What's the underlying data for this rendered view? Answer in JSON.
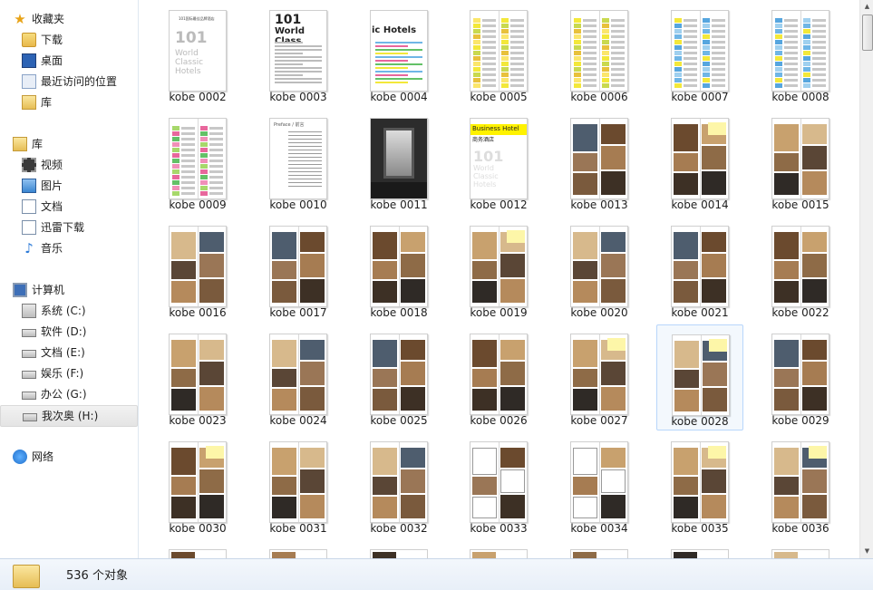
{
  "sidebar": {
    "favorites": {
      "label": "收藏夹",
      "icon": "star-icon"
    },
    "favorites_items": [
      {
        "label": "下载",
        "icon": "downloads-folder-icon"
      },
      {
        "label": "桌面",
        "icon": "desktop-icon"
      },
      {
        "label": "最近访问的位置",
        "icon": "recent-places-icon"
      },
      {
        "label": "库",
        "icon": "library-icon"
      }
    ],
    "libraries": {
      "label": "库",
      "icon": "libraries-icon"
    },
    "libraries_items": [
      {
        "label": "视频",
        "icon": "video-library-icon"
      },
      {
        "label": "图片",
        "icon": "pictures-library-icon"
      },
      {
        "label": "文档",
        "icon": "documents-library-icon"
      },
      {
        "label": "迅雷下载",
        "icon": "thunder-download-icon"
      },
      {
        "label": "音乐",
        "icon": "music-library-icon"
      }
    ],
    "computer": {
      "label": "计算机",
      "icon": "computer-icon"
    },
    "drives": [
      {
        "label": "系统 (C:)",
        "icon": "system-drive-icon"
      },
      {
        "label": "软件 (D:)",
        "icon": "drive-icon"
      },
      {
        "label": "文档 (E:)",
        "icon": "drive-icon"
      },
      {
        "label": "娱乐 (F:)",
        "icon": "drive-icon"
      },
      {
        "label": "办公 (G:)",
        "icon": "drive-icon"
      },
      {
        "label": "我次奥 (H:)",
        "icon": "drive-icon",
        "selected": true
      }
    ],
    "network": {
      "label": "网络",
      "icon": "network-icon"
    }
  },
  "files": [
    {
      "name": "kobe 0002",
      "style": "title",
      "text": [
        "101国际最佳品牌酒店",
        "101",
        "World",
        "Classic",
        "Hotels"
      ]
    },
    {
      "name": "kobe 0003",
      "style": "worldclass",
      "text": [
        "101",
        "World Class"
      ]
    },
    {
      "name": "kobe 0004",
      "style": "ichotels",
      "text": [
        "ic Hotels"
      ]
    },
    {
      "name": "kobe 0005",
      "style": "list-yellow"
    },
    {
      "name": "kobe 0006",
      "style": "list-yellow"
    },
    {
      "name": "kobe 0007",
      "style": "list-blue"
    },
    {
      "name": "kobe 0008",
      "style": "list-blue"
    },
    {
      "name": "kobe 0009",
      "style": "list-pink"
    },
    {
      "name": "kobe 0010",
      "style": "text",
      "text": [
        "Preface / 前言"
      ]
    },
    {
      "name": "kobe 0011",
      "style": "dark"
    },
    {
      "name": "kobe 0012",
      "style": "business",
      "text": [
        "Business Hotel",
        "商务酒店",
        "101",
        "World",
        "Classic",
        "Hotels"
      ]
    },
    {
      "name": "kobe 0013",
      "style": "photos"
    },
    {
      "name": "kobe 0014",
      "style": "photos-yellow"
    },
    {
      "name": "kobe 0015",
      "style": "photos"
    },
    {
      "name": "kobe 0016",
      "style": "photos"
    },
    {
      "name": "kobe 0017",
      "style": "photos"
    },
    {
      "name": "kobe 0018",
      "style": "photos"
    },
    {
      "name": "kobe 0019",
      "style": "photos-yellow"
    },
    {
      "name": "kobe 0020",
      "style": "photos"
    },
    {
      "name": "kobe 0021",
      "style": "photos"
    },
    {
      "name": "kobe 0022",
      "style": "photos"
    },
    {
      "name": "kobe 0023",
      "style": "photos"
    },
    {
      "name": "kobe 0024",
      "style": "photos"
    },
    {
      "name": "kobe 0025",
      "style": "photos"
    },
    {
      "name": "kobe 0026",
      "style": "photos"
    },
    {
      "name": "kobe 0027",
      "style": "photos-yellow"
    },
    {
      "name": "kobe 0028",
      "style": "photos-yellow",
      "selected": true
    },
    {
      "name": "kobe 0029",
      "style": "photos"
    },
    {
      "name": "kobe 0030",
      "style": "photos-yellow"
    },
    {
      "name": "kobe 0031",
      "style": "photos"
    },
    {
      "name": "kobe 0032",
      "style": "photos"
    },
    {
      "name": "kobe 0033",
      "style": "plans"
    },
    {
      "name": "kobe 0034",
      "style": "plans"
    },
    {
      "name": "kobe 0035",
      "style": "photos-yellow"
    },
    {
      "name": "kobe 0036",
      "style": "photos-yellow"
    }
  ],
  "colors": {
    "selection_bg": "#f3f8fd",
    "selection_border": "#b8d6fb",
    "status_bg": "#e8eff8"
  },
  "status": {
    "count_text": "536 个对象",
    "icon": "folder-icon"
  }
}
